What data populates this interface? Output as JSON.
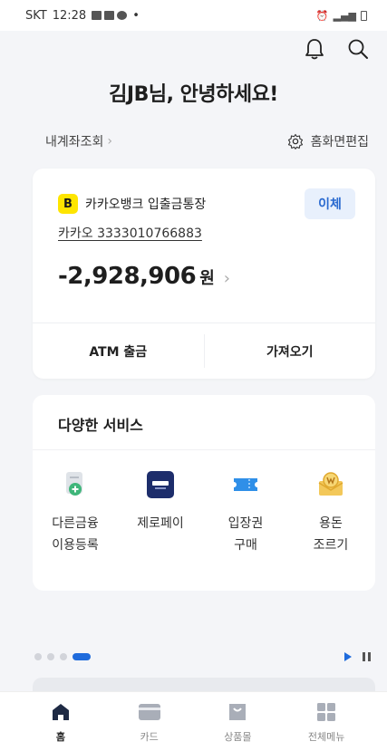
{
  "status_bar": {
    "carrier": "SKT",
    "time": "12:28",
    "notif_icons": [
      "gallery-icon",
      "photo-icon",
      "chat-icon"
    ],
    "dot": "•"
  },
  "header": {
    "greeting": "김JB님, 안녕하세요!",
    "icons": [
      "bell-icon",
      "search-icon"
    ]
  },
  "subbar": {
    "account_lookup": "내계좌조회",
    "account_lookup_chevron": "›",
    "home_edit": "홈화면편집"
  },
  "account": {
    "bank_logo_letter": "B",
    "name": "카카오뱅크 입출금통장",
    "number": "카카오 3333010766883",
    "balance": "-2,928,906",
    "currency": "원",
    "chevron": "›",
    "transfer_label": "이체",
    "actions": [
      "ATM 출금",
      "가져오기"
    ]
  },
  "services": {
    "title": "다양한 서비스",
    "items": [
      {
        "label": "다른금융\n이용등록",
        "icon": "register-finance-icon"
      },
      {
        "label": "제로페이",
        "icon": "zeropay-icon"
      },
      {
        "label": "입장권\n구매",
        "icon": "ticket-icon"
      },
      {
        "label": "용돈\n조르기",
        "icon": "allowance-envelope-icon"
      }
    ]
  },
  "pager": {
    "total_pages": 4,
    "active_page": 4
  },
  "bottom_nav": [
    {
      "label": "홈",
      "icon": "home-icon",
      "active": true
    },
    {
      "label": "카드",
      "icon": "card-icon",
      "active": false
    },
    {
      "label": "상품몰",
      "icon": "shopping-bag-icon",
      "active": false
    },
    {
      "label": "전체메뉴",
      "icon": "grid-menu-icon",
      "active": false
    }
  ],
  "colors": {
    "accent": "#1f6bdc",
    "kakao_yellow": "#fee500",
    "background": "#f4f5f8"
  }
}
